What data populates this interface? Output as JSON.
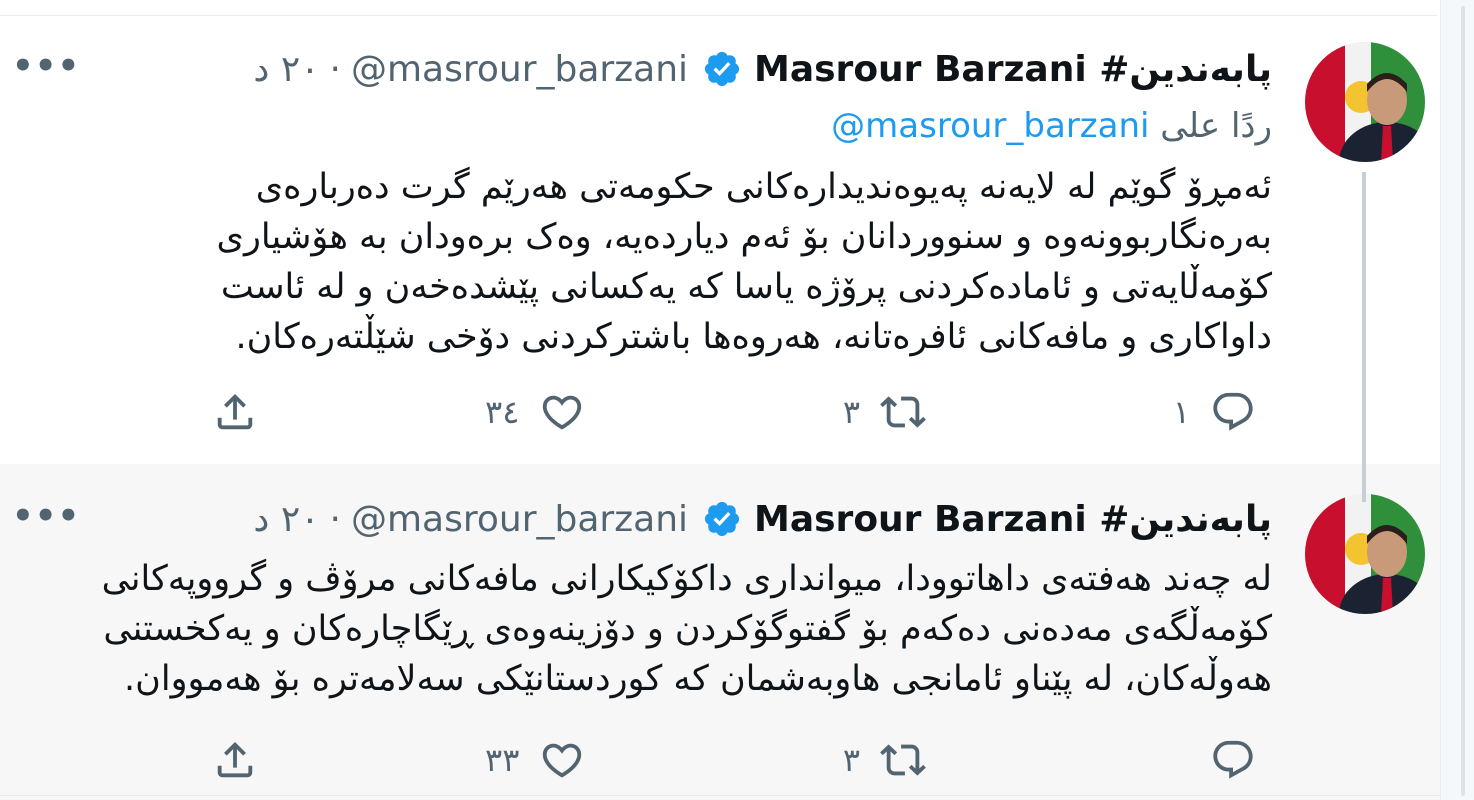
{
  "colors": {
    "accent": "#1d9bf0",
    "secondary_text": "#536471",
    "primary_text": "#0f1419",
    "thread_line": "#c4cfd6",
    "highlight_bg": "#f7f7f7"
  },
  "tweets": [
    {
      "display_name": "Masrour Barzani #پابەندین",
      "handle": "@masrour_barzani",
      "separator": "·",
      "time": "٢٠ د",
      "reply_to_label": "ردًا على",
      "reply_to_handle": "@masrour_barzani",
      "text": "ئەمڕۆ گوێم لە لایەنە پەیوەندیدارەکانی حکومەتی هەرێم گرت دەربارەی بەرەنگاربوونەوە و سنووردانان بۆ ئەم دیاردەیە، وەک برەودان بە هۆشیاری کۆمەڵایەتی و ئامادەکردنی پرۆژە یاسا کە یەکسانی پێشدەخەن و لە ئاست داواکاری و مافەکانی ئافرەتانە، هەروەها باشترکردنی دۆخی شێڵتەرەکان.",
      "reply_count": "١",
      "retweet_count": "٣",
      "like_count": "٣٤",
      "icons": [
        "verified-badge-icon",
        "more-options-icon",
        "reply-icon",
        "retweet-icon",
        "like-icon",
        "share-icon"
      ]
    },
    {
      "display_name": "Masrour Barzani #پابەندین",
      "handle": "@masrour_barzani",
      "separator": "·",
      "time": "٢٠ د",
      "text": "لە چەند هەفتەی داهاتوودا، میوانداری داکۆکیکارانی مافەکانی مرۆڤ و گرووپەکانی کۆمەڵگەی مەدەنی دەکەم بۆ گفتوگۆکردن و دۆزینەوەی ڕێگاچارەکان و یەکخستنی هەوڵەکان، لە پێناو ئامانجی هاوبەشمان کە کوردستانێکی سەلامەترە بۆ هەمووان.",
      "reply_count": "",
      "retweet_count": "٣",
      "like_count": "٣٣",
      "icons": [
        "verified-badge-icon",
        "more-options-icon",
        "reply-icon",
        "retweet-icon",
        "like-icon",
        "share-icon"
      ]
    }
  ]
}
